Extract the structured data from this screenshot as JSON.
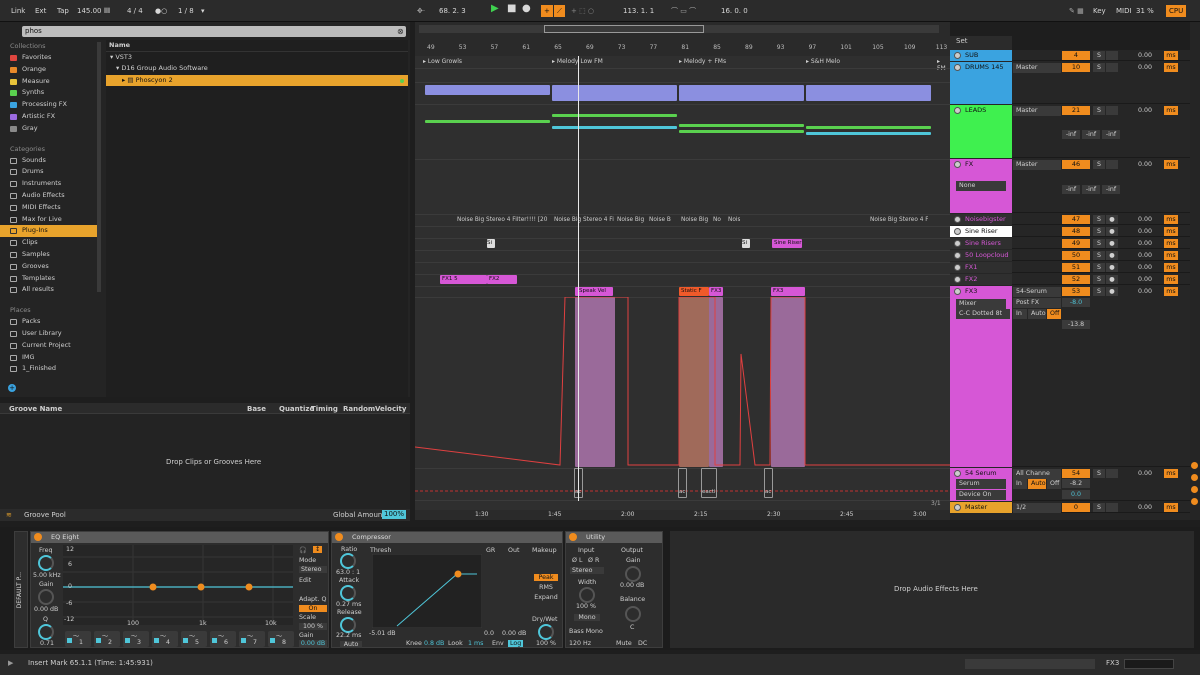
{
  "transport": {
    "link": "Link",
    "ext": "Ext",
    "tap": "Tap",
    "bpm": "145.00",
    "sig": "4 / 4",
    "quant": "1 / 8",
    "position": "68. 2. 3",
    "loop_start": "113. 1. 1",
    "loop_len": "16. 0. 0",
    "key": "Key",
    "midi": "MIDI",
    "cpu_pct": "31 %",
    "cpu": "CPU"
  },
  "browser": {
    "search": "phos",
    "collections_head": "Collections",
    "collections": [
      {
        "label": "Favorites",
        "color": "#e0463f"
      },
      {
        "label": "Orange",
        "color": "#e8892a"
      },
      {
        "label": "Measure",
        "color": "#e8c33a"
      },
      {
        "label": "Synths",
        "color": "#5ad14f"
      },
      {
        "label": "Processing FX",
        "color": "#3aa3e0"
      },
      {
        "label": "Artistic FX",
        "color": "#9b6be0"
      },
      {
        "label": "Gray",
        "color": "#8a8a8a"
      }
    ],
    "categories_head": "Categories",
    "categories": [
      {
        "label": "Sounds",
        "icon": "speaker-icon"
      },
      {
        "label": "Drums",
        "icon": "drum-icon"
      },
      {
        "label": "Instruments",
        "icon": "instrument-icon"
      },
      {
        "label": "Audio Effects",
        "icon": "audio-effects-icon"
      },
      {
        "label": "MIDI Effects",
        "icon": "midi-effects-icon"
      },
      {
        "label": "Max for Live",
        "icon": "max-icon"
      },
      {
        "label": "Plug-Ins",
        "icon": "plugin-icon"
      },
      {
        "label": "Clips",
        "icon": "clip-icon"
      },
      {
        "label": "Samples",
        "icon": "wave-icon"
      },
      {
        "label": "Grooves",
        "icon": "groove-icon"
      },
      {
        "label": "Templates",
        "icon": "template-icon"
      },
      {
        "label": "All results",
        "icon": "search-icon"
      }
    ],
    "places_head": "Places",
    "places": [
      {
        "label": "Packs"
      },
      {
        "label": "User Library"
      },
      {
        "label": "Current Project"
      },
      {
        "label": "IMG"
      },
      {
        "label": "1_Finished"
      }
    ],
    "list_header": "Name",
    "tree": [
      "VST3",
      "D16 Group Audio Software",
      "Phoscyon 2"
    ]
  },
  "groove": {
    "cols": [
      "Groove Name",
      "Base",
      "Quantize",
      "Timing",
      "Random",
      "Velocity"
    ],
    "drop": "Drop Clips or Grooves Here",
    "footer": "Groove Pool",
    "global": "Global Amount",
    "global_val": "100%"
  },
  "arrangement": {
    "bars": [
      "49",
      "53",
      "57",
      "61",
      "65",
      "69",
      "73",
      "77",
      "81",
      "85",
      "89",
      "93",
      "97",
      "101",
      "105",
      "109",
      "113"
    ],
    "locators": [
      "Low Growls",
      "Melody Low FM",
      "Melody + FMs",
      "S&H Melo",
      "FM"
    ],
    "noise_clips": [
      "Noise Big Stereo 4 Filter!!!! [20",
      "Noise Big Stereo 4 Fi",
      "Noise Big",
      "Noise B",
      "Noise Big",
      "No",
      "Nois",
      "Noise Big Stereo 4 F"
    ],
    "fx_clips": [
      "FX1 5",
      "FX2"
    ],
    "small_clips": [
      "Si",
      "Si",
      "Sine Riser"
    ],
    "automation_clips": [
      "Speak Vel",
      "Static F",
      "FX3",
      "FX3"
    ],
    "bottom_clips": [
      "ac",
      "ac",
      "eacti",
      "ac"
    ],
    "time": [
      "1:30",
      "1:45",
      "2:00",
      "2:15",
      "2:30",
      "2:45",
      "3:00"
    ],
    "zoom": "3/1"
  },
  "mixer": {
    "set": "Set",
    "tracks": [
      {
        "name": "SUB",
        "color": "#3aa3e0",
        "io": "",
        "num": "4",
        "vol": "0.00"
      },
      {
        "name": "DRUMS 145",
        "color": "#3aa3e0",
        "io": "Master",
        "num": "10",
        "vol": "0.00"
      },
      {
        "name": "LEADS",
        "color": "#3ff04f",
        "io": "Master",
        "num": "21",
        "vol": "0.00"
      },
      {
        "name": "FX",
        "color": "#d657d6",
        "io": "Master",
        "num": "46",
        "vol": "0.00"
      },
      {
        "name": "Noisebigster",
        "color": "#d657d6",
        "num": "47",
        "vol": "0.00"
      },
      {
        "name": "Sine Riser",
        "color": "#ffffff",
        "num": "48",
        "vol": "0.00"
      },
      {
        "name": "Sine Risers",
        "color": "#d657d6",
        "num": "49",
        "vol": "0.00"
      },
      {
        "name": "50 Loopcloud",
        "color": "#d657d6",
        "num": "50",
        "vol": "0.00"
      },
      {
        "name": "FX1",
        "color": "#d657d6",
        "num": "51",
        "vol": "0.00"
      },
      {
        "name": "FX2",
        "color": "#d657d6",
        "num": "52",
        "vol": "0.00"
      },
      {
        "name": "FX3",
        "color": "#d657d6",
        "io": "54-Serum",
        "num": "53",
        "vol": "0.00"
      },
      {
        "name": "54 Serum",
        "color": "#d657d6",
        "io": "All Channe",
        "num": "54",
        "vol": "0.00"
      },
      {
        "name": "Master",
        "color": "#e8a32c",
        "io": "1/2",
        "num": "0",
        "vol": "0.00"
      }
    ],
    "fx_none": "None",
    "mixer_label": "Mixer",
    "cc_dotted": "C-C Dotted 8t",
    "post_fx": "Post FX",
    "in": "In",
    "auto": "Auto",
    "off": "Off",
    "vals": [
      "-8.0",
      "-13.8",
      "-8.2",
      "0.0"
    ],
    "serum": "Serum",
    "device_on": "Device On",
    "inf": "-inf",
    "s": "S",
    "c": "C",
    "ms": "ms"
  },
  "devices": {
    "rack": "DEFAULT P...",
    "eq": {
      "title": "EQ Eight",
      "freq": "Freq",
      "freq_val": "5.00 kHz",
      "gain": "Gain",
      "gain_val": "0.00 dB",
      "q": "Q",
      "q_val": "0.71",
      "mode": "Mode",
      "stereo": "Stereo",
      "edit": "Edit",
      "adapt": "Adapt. Q",
      "on": "On",
      "scale": "Scale",
      "scale_val": "100 %",
      "gain2": "Gain",
      "gain2_val": "0.00 dB",
      "db": [
        "12",
        "6",
        "0",
        "-6",
        "-12"
      ],
      "freqs": [
        "100",
        "1k",
        "10k"
      ],
      "bands": [
        "1",
        "2",
        "3",
        "4",
        "5",
        "6",
        "7",
        "8"
      ]
    },
    "comp": {
      "title": "Compressor",
      "ratio": "Ratio",
      "ratio_val": "63.0 : 1",
      "attack": "Attack",
      "attack_val": "0.27 ms",
      "release": "Release",
      "release_val": "22.2 ms",
      "auto": "Auto",
      "thresh": "Thresh",
      "gr": "GR",
      "out": "Out",
      "thresh_val": "-5.01 dB",
      "gr_val": "0.0",
      "out_val": "0.00 dB",
      "knee": "Knee",
      "knee_val": "0.8 dB",
      "look": "Look",
      "look_val": "1 ms",
      "env": "Env",
      "log": "Log",
      "makeup": "Makeup",
      "peak": "Peak",
      "rms": "RMS",
      "expand": "Expand",
      "drywet": "Dry/Wet",
      "drywet_val": "100 %"
    },
    "util": {
      "title": "Utility",
      "input": "Input",
      "output": "Output",
      "l": "Ø L",
      "r": "Ø R",
      "stereo": "Stereo",
      "width": "Width",
      "width_val": "100 %",
      "mono": "Mono",
      "bass": "Bass Mono",
      "hz": "120 Hz",
      "gain": "Gain",
      "gain_val": "0.00 dB",
      "balance": "Balance",
      "c": "C",
      "mute": "Mute",
      "dc": "DC"
    },
    "drop": "Drop Audio Effects Here"
  },
  "status": {
    "text": "Insert Mark 65.1.1 (Time: 1:45:931)",
    "right": "FX3"
  }
}
